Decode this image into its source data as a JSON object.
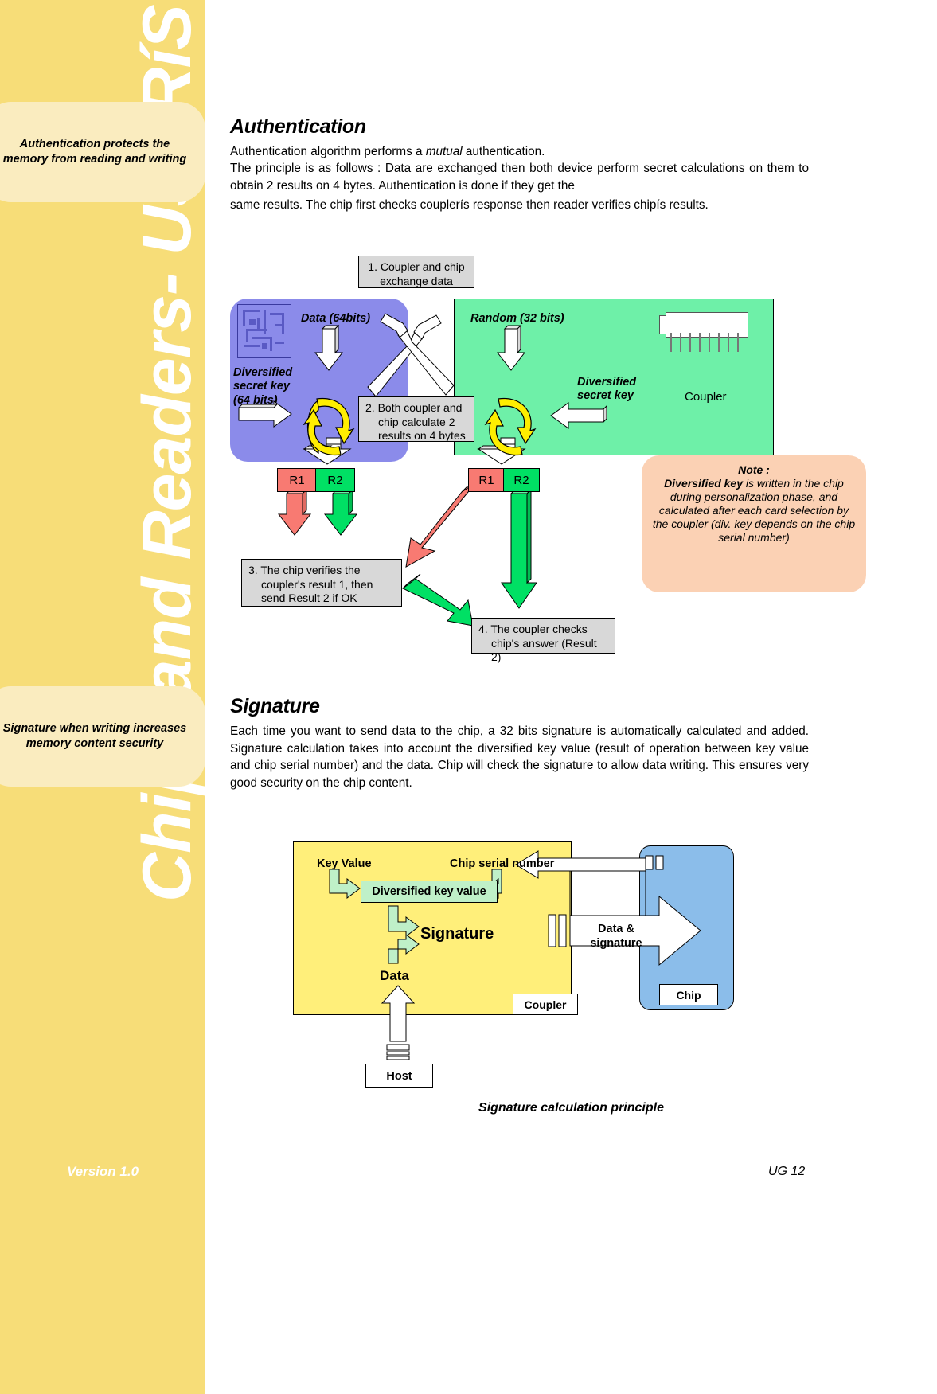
{
  "sidebar": {
    "vertical_title": "Chips and Readers- USERíS GUIDE",
    "callout_auth": "Authentication protects the memory from reading and writing",
    "callout_sig": "Signature when writing increases memory content security",
    "version": "Version 1.0"
  },
  "footer": {
    "page": "UG 12"
  },
  "authentication": {
    "heading": "Authentication",
    "p1": "Authentication algorithm performs a mutual authentication.",
    "p1_pre": "Authentication algorithm performs a ",
    "p1_em": "mutual",
    "p1_post": " authentication.",
    "p2": "The principle is as follows : Data are exchanged then both device perform secret calculations on them to obtain 2 results on 4 bytes. Authentication is done if they get the",
    "p3": "same results. The chip first checks couplerís response then reader verifies chipís results.",
    "diagram": {
      "step1": "1. Coupler and chip exchange data",
      "step2": "2. Both coupler and chip calculate 2 results on 4 bytes",
      "step3": "3. The chip verifies the coupler's result 1, then send Result 2 if OK",
      "step4": "4. The coupler checks chip's answer (Result 2)",
      "label_data": "Data (64bits)",
      "label_random": "Random (32 bits)",
      "label_divkey_chip": "Diversified secret key (64 bits)",
      "label_divkey_chip_l1": "Diversified",
      "label_divkey_chip_l2": "secret key",
      "label_divkey_chip_l3": "(64 bits)",
      "label_divkey_coupler_l1": "Diversified",
      "label_divkey_coupler_l2": "secret key",
      "label_coupler": "Coupler",
      "r1": "R1",
      "r2": "R2",
      "note_title": "Note :",
      "note_bold": "Diversified key",
      "note_rest": " is written in the chip during personalization phase, and calculated after each card selection by the coupler (div. key depends on the chip serial number)",
      "colors": {
        "chip_panel": "#8b8bea",
        "coupler_panel": "#6ef0a8",
        "r1": "#f87a72",
        "r2": "#00e064",
        "callbox": "#d8d8d8",
        "note": "#fbd1b4",
        "cycle_arrow": "#ffee00"
      }
    }
  },
  "signature": {
    "heading": "Signature",
    "p1": "Each time you want to send data to the chip, a 32 bits signature is automatically calculated and added. Signature calculation takes into account the diversified key value (result of operation between key value and chip serial number) and the data. Chip will check the signature to allow data writing. This ensures very good security on the chip content.",
    "diagram": {
      "key_value": "Key Value",
      "chip_serial_number": "Chip serial number",
      "diversified_key_value": "Diversified key value",
      "signature": "Signature",
      "data": "Data",
      "data_and_signature_l1": "Data &",
      "data_and_signature_l2": "signature",
      "coupler": "Coupler",
      "chip": "Chip",
      "host": "Host",
      "colors": {
        "coupler_box": "#ffef7a",
        "chip_shape": "#8bbdea",
        "dkv_box": "#bff0c8",
        "green_arrow": "#bff0c8"
      }
    },
    "caption": "Signature calculation principle"
  }
}
